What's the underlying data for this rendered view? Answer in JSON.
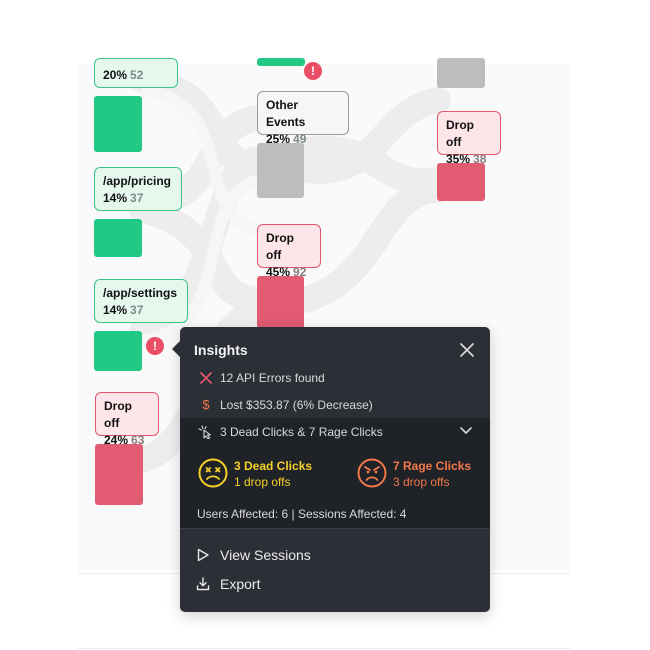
{
  "colors": {
    "green": "#21c985",
    "gray": "#bdbdbd",
    "red": "#e15b72",
    "popover_bg": "#2c2f36",
    "dead_clicks": "#f5d02b",
    "rage_clicks": "#f2784b"
  },
  "nodes": [
    {
      "id": "node-top",
      "pct": "20%",
      "count": "52"
    },
    {
      "id": "node-pricing",
      "name": "/app/pricing",
      "pct": "14%",
      "count": "37"
    },
    {
      "id": "node-settings",
      "name": "/app/settings",
      "pct": "14%",
      "count": "37"
    },
    {
      "id": "node-dropoff-col1",
      "name": "Drop off",
      "pct": "24%",
      "count": "63"
    },
    {
      "id": "node-other-events",
      "name": "Other Events",
      "pct": "25%",
      "count": "49"
    },
    {
      "id": "node-dropoff-col2",
      "name": "Drop off",
      "pct": "45%",
      "count": "92"
    },
    {
      "id": "node-dropoff-col3",
      "name": "Drop off",
      "pct": "35%",
      "count": "38"
    }
  ],
  "alert_glyph": "!",
  "insights": {
    "title": "Insights",
    "close_icon": "close-icon",
    "api_errors": "12 API Errors found",
    "api_errors_icon": "x-icon",
    "lost": "Lost $353.87 (6% Decrease)",
    "lost_icon": "dollar-icon",
    "lost_glyph": "$",
    "clicks_summary": "3 Dead Clicks & 7 Rage Clicks",
    "clicks_icon": "cursor-click-icon",
    "dead_clicks": {
      "title": "3 Dead Clicks",
      "sub": "1 drop offs",
      "icon": "dead-face-icon"
    },
    "rage_clicks": {
      "title": "7 Rage Clicks",
      "sub": "3 drop offs",
      "icon": "angry-face-icon"
    },
    "affected": "Users Affected: 6 | Sessions Affected: 4",
    "view_sessions": "View Sessions",
    "export": "Export"
  }
}
